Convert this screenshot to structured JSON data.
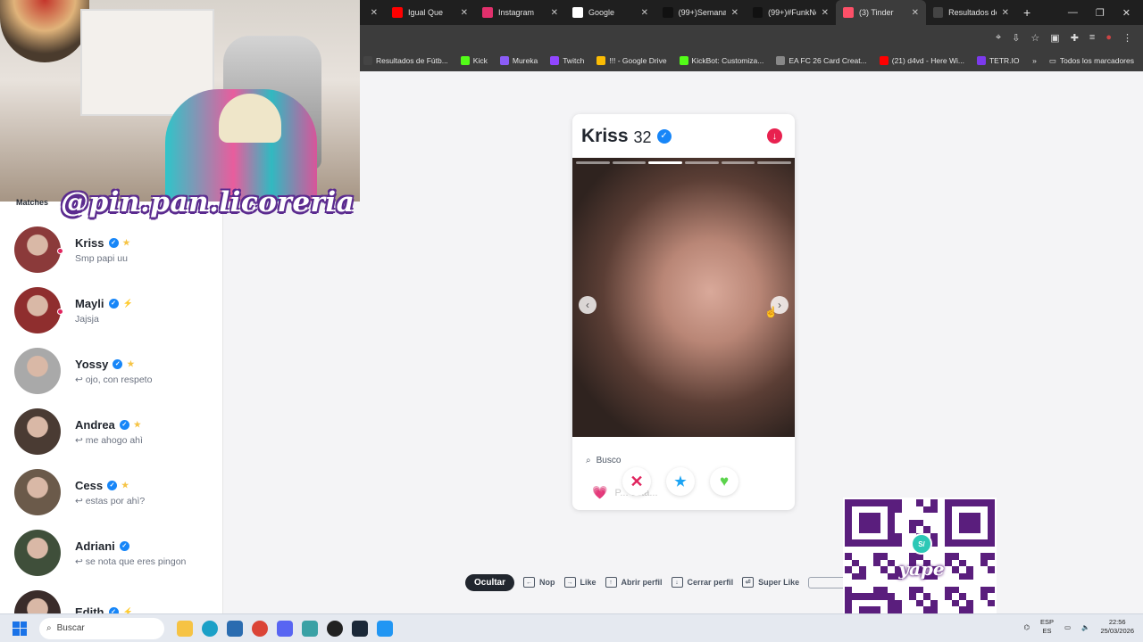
{
  "browser": {
    "tabs": [
      {
        "label": "Igual Que",
        "color": "#ff0000",
        "active": false
      },
      {
        "label": "Instagram",
        "color": "#e1306c",
        "active": false
      },
      {
        "label": "Google",
        "color": "#ffffff",
        "active": false
      },
      {
        "label": "(99+)Semana",
        "color": "#111111",
        "active": false
      },
      {
        "label": "(99+)#FunkNo",
        "color": "#111111",
        "active": false
      },
      {
        "label": "(3) Tinder",
        "color": "#fd5068",
        "active": true
      },
      {
        "label": "Resultados de",
        "color": "#444444",
        "active": false
      }
    ],
    "bookmarks": [
      {
        "label": "Resultados de Fútb...",
        "color": "#444"
      },
      {
        "label": "Kick",
        "color": "#53fc18"
      },
      {
        "label": "Mureka",
        "color": "#8b5cf6"
      },
      {
        "label": "Twitch",
        "color": "#9146ff"
      },
      {
        "label": "!!! - Google Drive",
        "color": "#fbbc04"
      },
      {
        "label": "KickBot: Customiza...",
        "color": "#53fc18"
      },
      {
        "label": "EA FC 26 Card Creat...",
        "color": "#888"
      },
      {
        "label": "(21) d4vd - Here Wi...",
        "color": "#ff0000"
      },
      {
        "label": "TETR.IO",
        "color": "#7c3aed"
      }
    ],
    "all_bookmarks": "Todos los marcadores"
  },
  "stream": {
    "watermark": "@pin.pan.licoreria"
  },
  "sidebar": {
    "header": "Matches",
    "matches": [
      {
        "name": "Kriss",
        "message": "Smp papi uu",
        "badge": "★",
        "unread": true,
        "avatar": "#8b3a3a"
      },
      {
        "name": "Mayli",
        "message": "Jajsja",
        "badge": "⚡",
        "unread": true,
        "avatar": "#8f2e2e"
      },
      {
        "name": "Yossy",
        "message": "↩ ojo, con respeto",
        "badge": "★",
        "unread": false,
        "avatar": "#a9a9a9"
      },
      {
        "name": "Andrea",
        "message": "↩ me ahogo ahì",
        "badge": "★",
        "unread": false,
        "avatar": "#4a3b33"
      },
      {
        "name": "Cess",
        "message": "↩ estas por ahì?",
        "badge": "★",
        "unread": false,
        "avatar": "#6b5a4a"
      },
      {
        "name": "Adriani",
        "message": "↩ se nota que eres pingon",
        "badge": "",
        "unread": false,
        "avatar": "#3f4f3a"
      },
      {
        "name": "Edith",
        "message": "",
        "badge": "⚡",
        "unread": false,
        "avatar": "#3a2c2a"
      }
    ]
  },
  "profile": {
    "name": "Kriss",
    "age": "32",
    "busco": "Busco",
    "looking_for": "P... esta...",
    "photo_count": 6,
    "photo_index": 3
  },
  "actions": {
    "nope": "✕",
    "super_like": "★",
    "like": "♥"
  },
  "shortcuts": {
    "hide": "Ocultar",
    "items": [
      {
        "key": "←",
        "label": "Nop"
      },
      {
        "key": "→",
        "label": "Like"
      },
      {
        "key": "↑",
        "label": "Abrir perfil"
      },
      {
        "key": "↓",
        "label": "Cerrar perfil"
      },
      {
        "key": "⏎",
        "label": "Super Like"
      }
    ]
  },
  "qr": {
    "badge": "S/",
    "brand": "yape"
  },
  "taskbar": {
    "search_placeholder": "Buscar",
    "lang": "ESP",
    "region": "ES",
    "time": "22:56",
    "date": "25/03/2026"
  },
  "colors": {
    "tinder_red": "#e8214f",
    "verified_blue": "#1786f8",
    "yape_purple": "#5a1e7d"
  }
}
